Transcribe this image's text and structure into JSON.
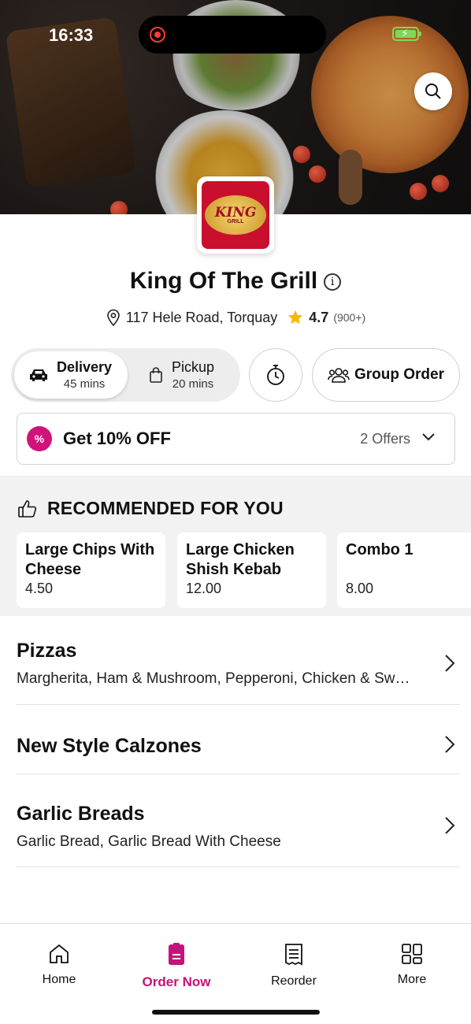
{
  "status_bar": {
    "time": "16:33"
  },
  "restaurant": {
    "name": "King Of The Grill",
    "logo_text_main": "KING",
    "logo_text_sub": "GRILL",
    "address": "117 Hele Road, Torquay",
    "rating": "4.7",
    "rating_count": "(900+)"
  },
  "order_mode": {
    "delivery": {
      "label": "Delivery",
      "time": "45 mins",
      "selected": true
    },
    "pickup": {
      "label": "Pickup",
      "time": "20 mins",
      "selected": false
    },
    "group_order_label": "Group Order"
  },
  "offers": {
    "headline": "Get 10% OFF",
    "count_label": "2 Offers",
    "badge_icon": "%"
  },
  "recommended": {
    "title": "RECOMMENDED FOR YOU",
    "items": [
      {
        "name": "Large Chips With Cheese",
        "price": "4.50"
      },
      {
        "name": "Large Chicken Shish Kebab",
        "price": "12.00"
      },
      {
        "name": "Combo 1",
        "price": "8.00"
      }
    ]
  },
  "categories": [
    {
      "name": "Pizzas",
      "description": "Margherita, Ham & Mushroom, Pepperoni, Chicken & Sweetcorn"
    },
    {
      "name": "New Style Calzones",
      "description": ""
    },
    {
      "name": "Garlic Breads",
      "description": "Garlic Bread, Garlic Bread With Cheese"
    }
  ],
  "bottom_nav": {
    "items": [
      {
        "label": "Home",
        "icon": "home-icon"
      },
      {
        "label": "Order Now",
        "icon": "order-icon",
        "active": true
      },
      {
        "label": "Reorder",
        "icon": "receipt-icon"
      },
      {
        "label": "More",
        "icon": "grid-icon"
      }
    ]
  },
  "colors": {
    "accent": "#c4137a",
    "offer_badge": "#d1127b",
    "star": "#f5b800",
    "battery": "#7ed957",
    "logo_bg": "#c8102e"
  }
}
